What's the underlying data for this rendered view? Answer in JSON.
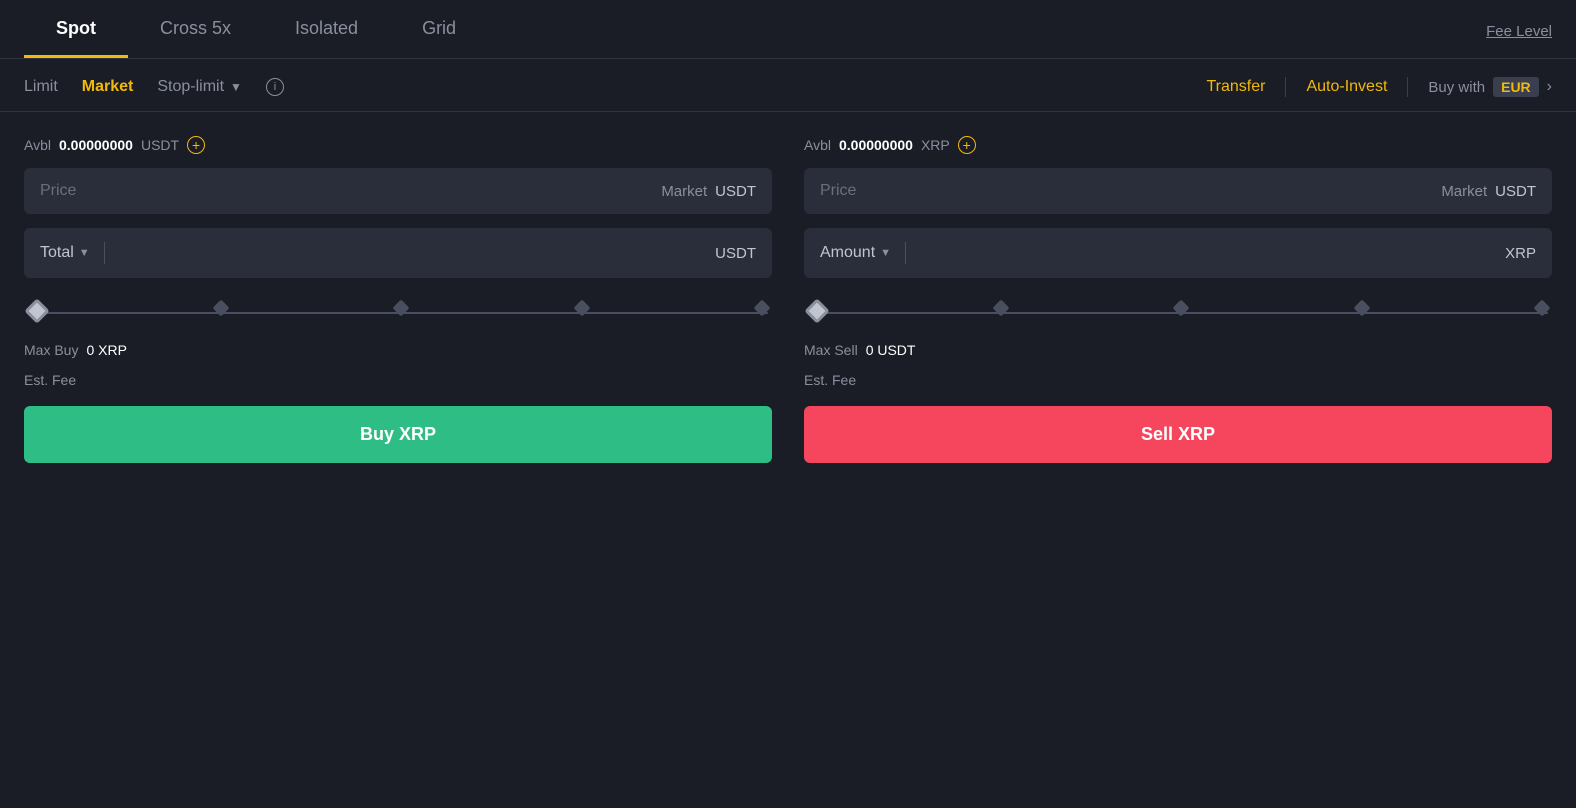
{
  "tabs": [
    {
      "id": "spot",
      "label": "Spot",
      "active": true
    },
    {
      "id": "cross5x",
      "label": "Cross 5x",
      "active": false
    },
    {
      "id": "isolated",
      "label": "Isolated",
      "active": false
    },
    {
      "id": "grid",
      "label": "Grid",
      "active": false
    }
  ],
  "fee_level": "Fee Level",
  "order_types": [
    {
      "id": "limit",
      "label": "Limit",
      "active": false
    },
    {
      "id": "market",
      "label": "Market",
      "active": true
    },
    {
      "id": "stop_limit",
      "label": "Stop-limit",
      "active": false
    }
  ],
  "right_actions": {
    "transfer": "Transfer",
    "auto_invest": "Auto-Invest",
    "buy_with_label": "Buy with",
    "buy_with_currency": "EUR"
  },
  "buy_panel": {
    "avbl_label": "Avbl",
    "avbl_value": "0.00000000",
    "avbl_currency": "USDT",
    "price_placeholder": "Price",
    "price_market": "Market",
    "price_currency": "USDT",
    "total_label": "Total",
    "total_currency": "USDT",
    "max_buy_label": "Max Buy",
    "max_buy_value": "0 XRP",
    "est_fee_label": "Est. Fee",
    "buy_button": "Buy XRP"
  },
  "sell_panel": {
    "avbl_label": "Avbl",
    "avbl_value": "0.00000000",
    "avbl_currency": "XRP",
    "price_placeholder": "Price",
    "price_market": "Market",
    "price_currency": "USDT",
    "amount_label": "Amount",
    "amount_currency": "XRP",
    "max_sell_label": "Max Sell",
    "max_sell_value": "0 USDT",
    "est_fee_label": "Est. Fee",
    "sell_button": "Sell XRP"
  },
  "colors": {
    "accent_yellow": "#f0b90b",
    "buy_green": "#2ebd85",
    "sell_red": "#f6465d",
    "bg_dark": "#1a1d26",
    "bg_input": "#2a2d3a",
    "text_muted": "#8a8f9e",
    "text_light": "#c0c5d0",
    "text_white": "#ffffff"
  }
}
